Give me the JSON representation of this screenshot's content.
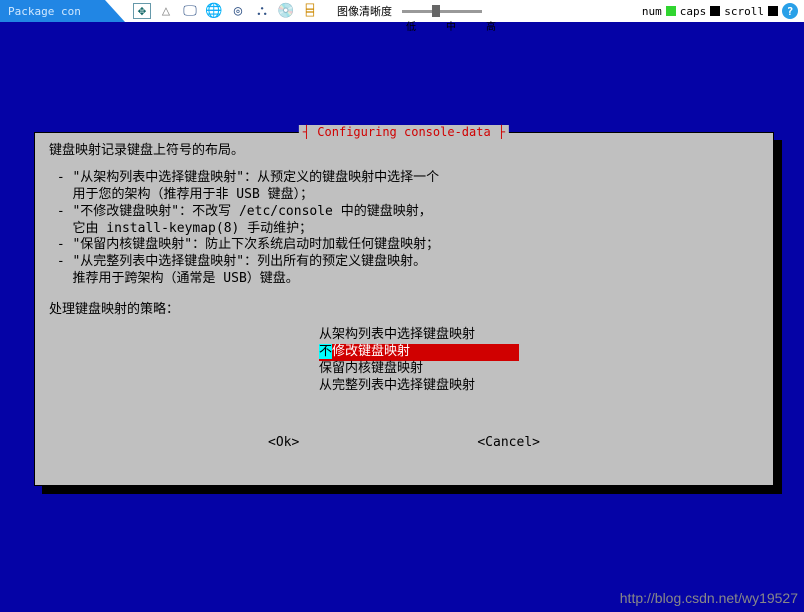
{
  "toolbar": {
    "title": "Package con",
    "clarity_label": "图像清晰度",
    "slider": {
      "low": "低",
      "mid": "中",
      "high": "高"
    },
    "status": {
      "num": "num",
      "caps": "caps",
      "scroll": "scroll"
    },
    "help": "?"
  },
  "dialog": {
    "title": "Configuring console-data",
    "intro": "键盘映射记录键盘上符号的布局。",
    "bullets": [
      {
        "l1": " - \"从架构列表中选择键盘映射\"：从预定义的键盘映射中选择一个",
        "l2": "   用于您的架构（推荐用于非 USB 键盘）；"
      },
      {
        "l1": " - \"不修改键盘映射\"：不改写 /etc/console 中的键盘映射，",
        "l2": "   它由 install-keymap(8) 手动维护；"
      },
      {
        "l1": " - \"保留内核键盘映射\"：防止下次系统启动时加载任何键盘映射；",
        "l2": ""
      },
      {
        "l1": " - \"从完整列表中选择键盘映射\"：列出所有的预定义键盘映射。",
        "l2": "   推荐用于跨架构（通常是 USB）键盘。"
      }
    ],
    "policy_label": "处理键盘映射的策略：",
    "options": [
      "从架构列表中选择键盘映射",
      "不修改键盘映射",
      "保留内核键盘映射",
      "从完整列表中选择键盘映射"
    ],
    "selected_index": 1,
    "ok": "<Ok>",
    "cancel": "<Cancel>"
  },
  "watermark": "http://blog.csdn.net/wy19527"
}
